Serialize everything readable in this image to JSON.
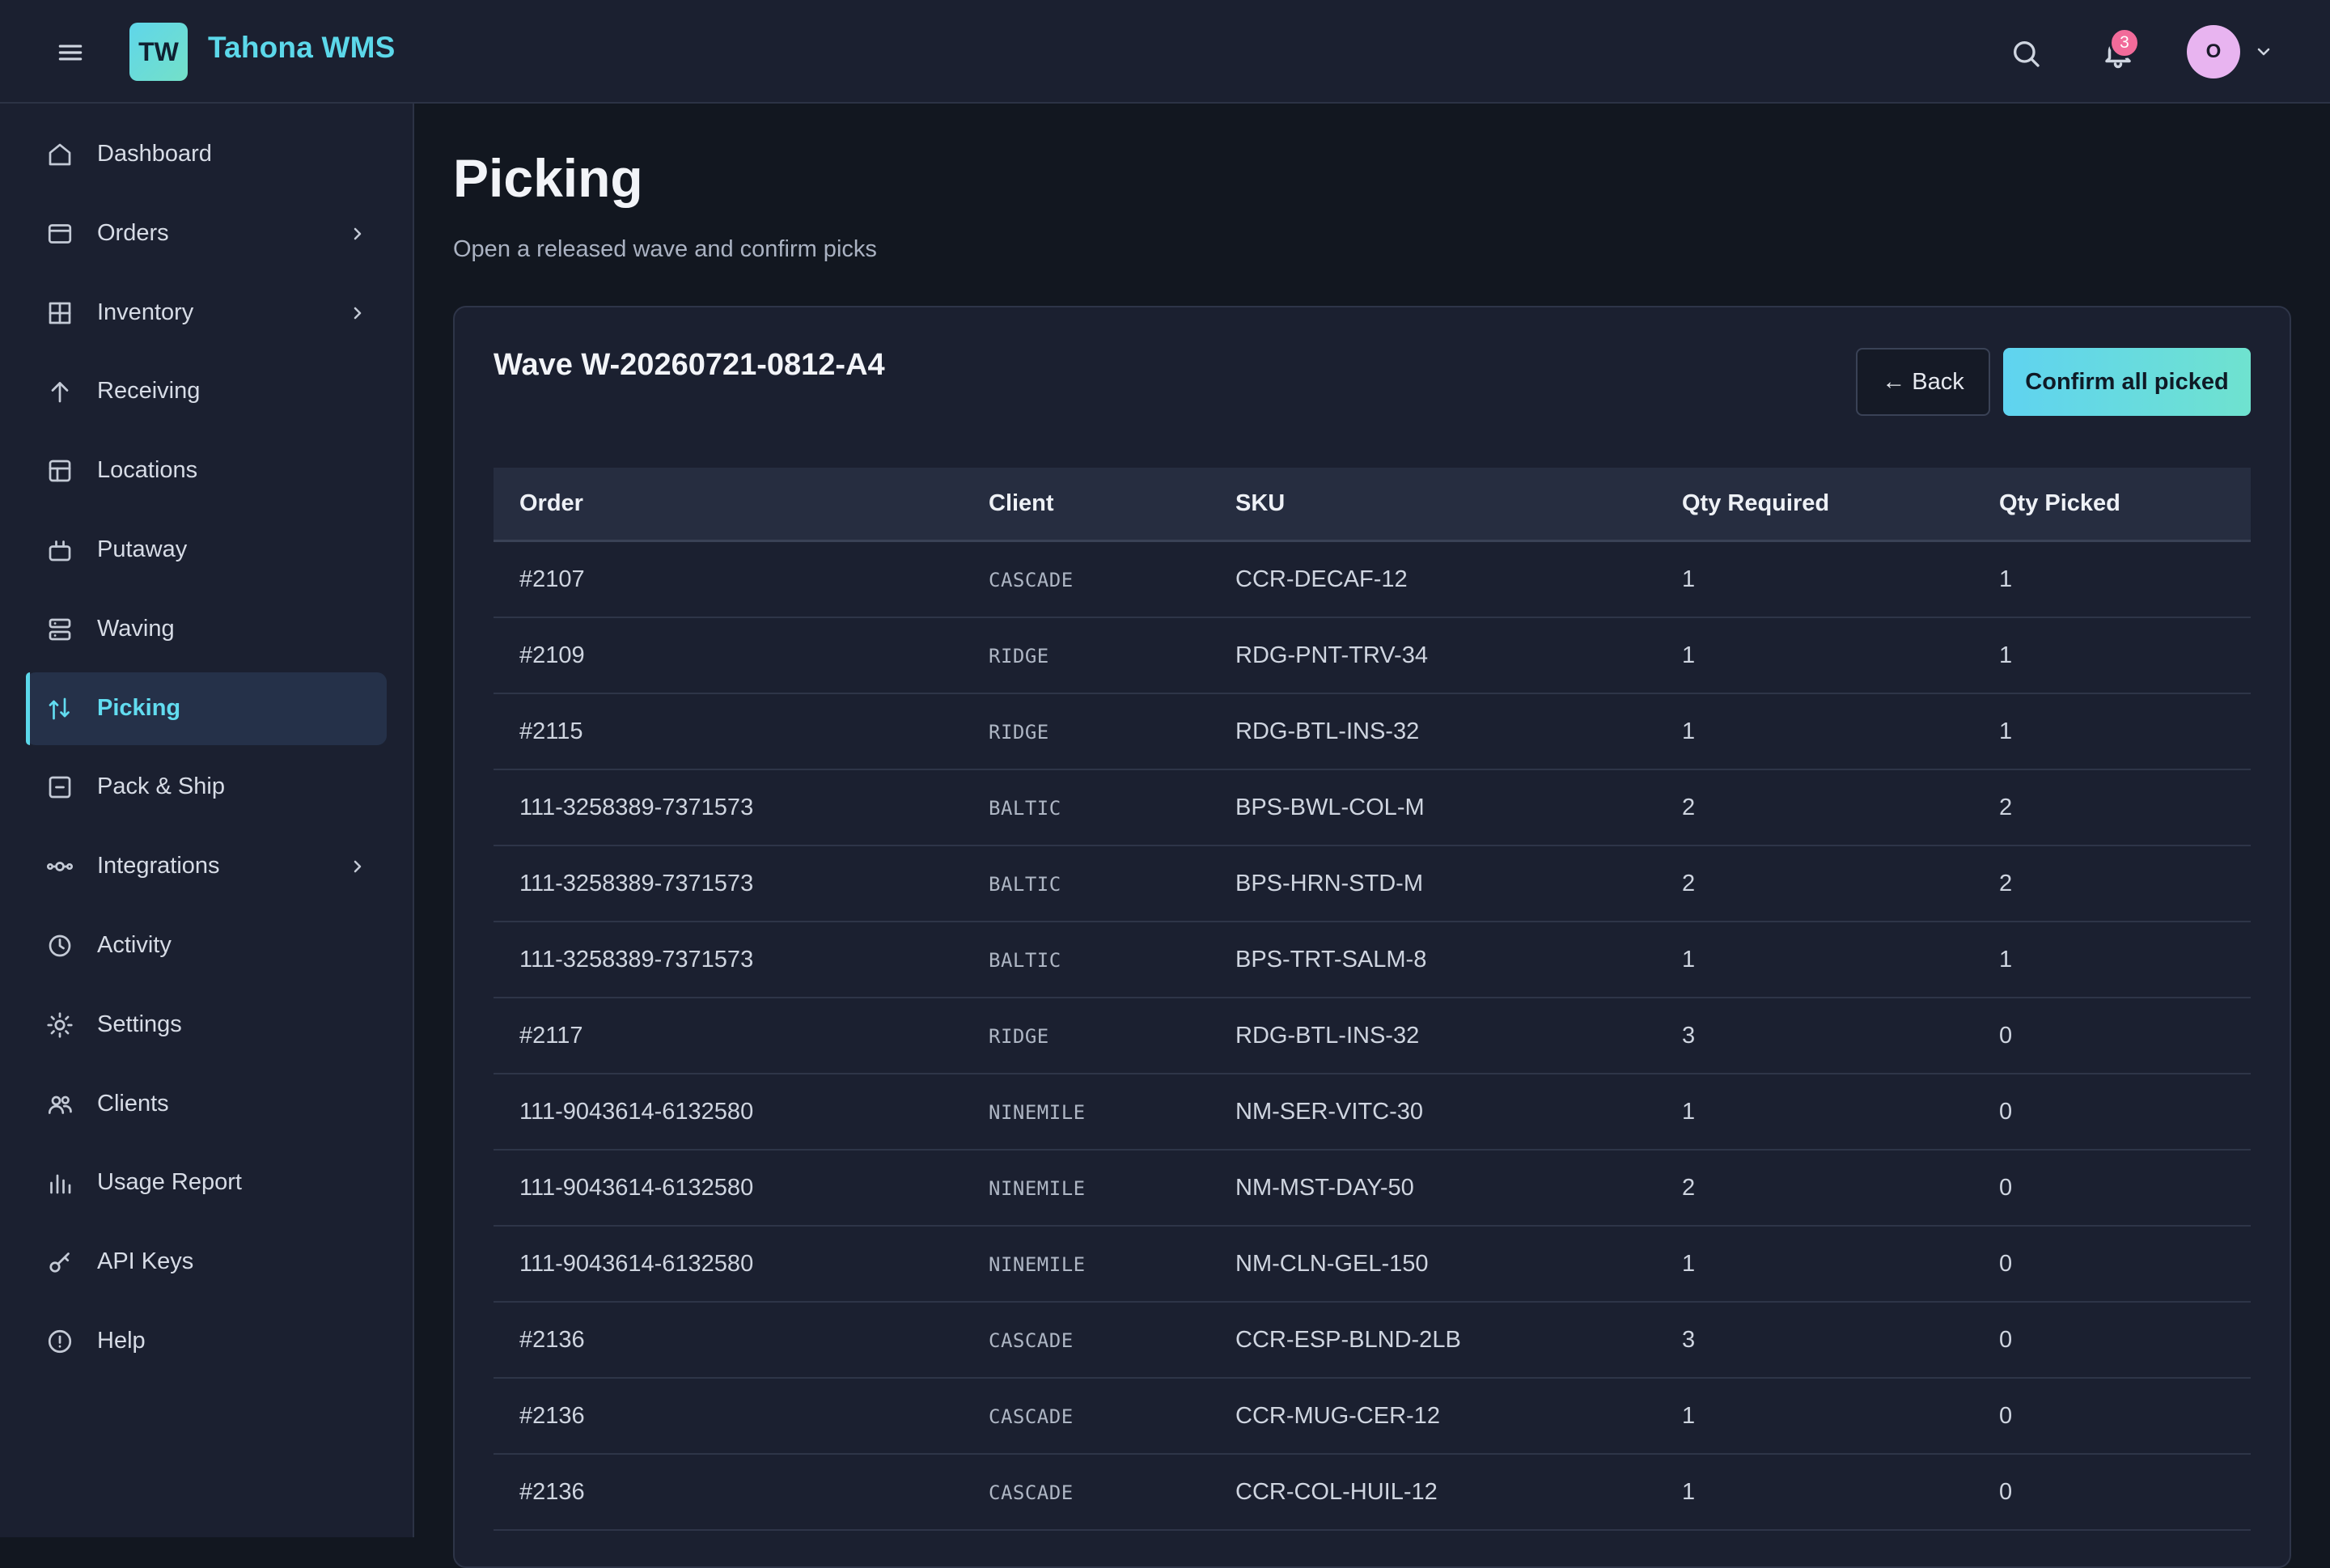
{
  "app": {
    "logo_initials": "TW",
    "title": "Tahona WMS"
  },
  "header": {
    "notification_count": "3",
    "user_initial": "O"
  },
  "sidebar": {
    "items": [
      {
        "label": "Dashboard",
        "icon": "home-icon",
        "has_submenu": false,
        "active": false
      },
      {
        "label": "Orders",
        "icon": "orders-icon",
        "has_submenu": true,
        "active": false
      },
      {
        "label": "Inventory",
        "icon": "grid-icon",
        "has_submenu": true,
        "active": false
      },
      {
        "label": "Receiving",
        "icon": "arrow-up-icon",
        "has_submenu": false,
        "active": false
      },
      {
        "label": "Locations",
        "icon": "locations-icon",
        "has_submenu": false,
        "active": false
      },
      {
        "label": "Putaway",
        "icon": "putaway-icon",
        "has_submenu": false,
        "active": false
      },
      {
        "label": "Waving",
        "icon": "waving-icon",
        "has_submenu": false,
        "active": false
      },
      {
        "label": "Picking",
        "icon": "picking-icon",
        "has_submenu": false,
        "active": true
      },
      {
        "label": "Pack & Ship",
        "icon": "pack-icon",
        "has_submenu": false,
        "active": false
      },
      {
        "label": "Integrations",
        "icon": "integrations-icon",
        "has_submenu": true,
        "active": false
      },
      {
        "label": "Activity",
        "icon": "clock-icon",
        "has_submenu": false,
        "active": false
      },
      {
        "label": "Settings",
        "icon": "gear-icon",
        "has_submenu": false,
        "active": false
      },
      {
        "label": "Clients",
        "icon": "users-icon",
        "has_submenu": false,
        "active": false
      },
      {
        "label": "Usage Report",
        "icon": "bar-chart-icon",
        "has_submenu": false,
        "active": false
      },
      {
        "label": "API Keys",
        "icon": "key-icon",
        "has_submenu": false,
        "active": false
      },
      {
        "label": "Help",
        "icon": "help-icon",
        "has_submenu": false,
        "active": false
      }
    ]
  },
  "page": {
    "title": "Picking",
    "subtitle": "Open a released wave and confirm picks"
  },
  "wave": {
    "title": "Wave W-20260721-0812-A4",
    "back_label": "← Back",
    "confirm_label": "Confirm all picked"
  },
  "table": {
    "columns": [
      "Order",
      "Client",
      "SKU",
      "Qty Required",
      "Qty Picked"
    ],
    "rows": [
      [
        "#2107",
        "CASCADE",
        "CCR-DECAF-12",
        "1",
        "1"
      ],
      [
        "#2109",
        "RIDGE",
        "RDG-PNT-TRV-34",
        "1",
        "1"
      ],
      [
        "#2115",
        "RIDGE",
        "RDG-BTL-INS-32",
        "1",
        "1"
      ],
      [
        "111-3258389-7371573",
        "BALTIC",
        "BPS-BWL-COL-M",
        "2",
        "2"
      ],
      [
        "111-3258389-7371573",
        "BALTIC",
        "BPS-HRN-STD-M",
        "2",
        "2"
      ],
      [
        "111-3258389-7371573",
        "BALTIC",
        "BPS-TRT-SALM-8",
        "1",
        "1"
      ],
      [
        "#2117",
        "RIDGE",
        "RDG-BTL-INS-32",
        "3",
        "0"
      ],
      [
        "111-9043614-6132580",
        "NINEMILE",
        "NM-SER-VITC-30",
        "1",
        "0"
      ],
      [
        "111-9043614-6132580",
        "NINEMILE",
        "NM-MST-DAY-50",
        "2",
        "0"
      ],
      [
        "111-9043614-6132580",
        "NINEMILE",
        "NM-CLN-GEL-150",
        "1",
        "0"
      ],
      [
        "#2136",
        "CASCADE",
        "CCR-ESP-BLND-2LB",
        "3",
        "0"
      ],
      [
        "#2136",
        "CASCADE",
        "CCR-MUG-CER-12",
        "1",
        "0"
      ],
      [
        "#2136",
        "CASCADE",
        "CCR-COL-HUIL-12",
        "1",
        "0"
      ]
    ]
  },
  "colors": {
    "accent": "#5cd8ea",
    "background": "#121720",
    "panel": "#1b2030",
    "badge": "#f26b9a",
    "avatar": "#e8b4f0"
  }
}
